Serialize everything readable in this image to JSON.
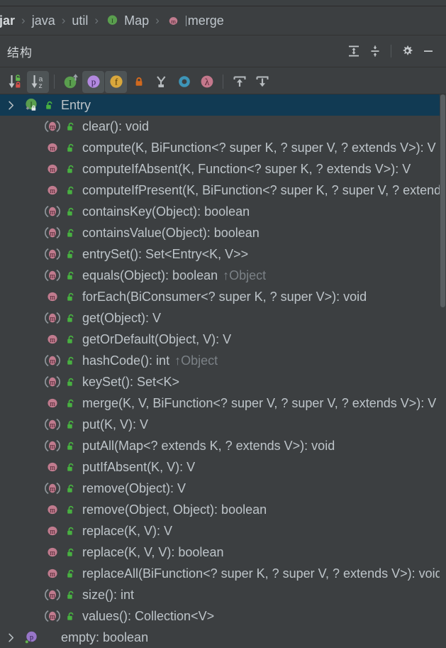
{
  "colors": {
    "background": "#3c3f41",
    "selection": "#113a53",
    "text": "#bdc4c9",
    "inherited_text": "#7b8186",
    "method_icon": "#c07b8e",
    "property_icon": "#9876c8",
    "field_icon": "#d4a24a",
    "interface_icon": "#5a9e4e",
    "lock_green": "#4caf50",
    "lock_red": "#d9534f",
    "lock_orange": "#d2691e",
    "lambda_icon": "#c4788c",
    "interface_ring": "#3d95b8"
  },
  "breadcrumb": {
    "items": [
      {
        "label": ".jar",
        "icon": null,
        "bold": true
      },
      {
        "label": "java",
        "icon": null,
        "bold": false
      },
      {
        "label": "util",
        "icon": null,
        "bold": false
      },
      {
        "label": "Map",
        "icon": "interface-icon",
        "bold": false
      },
      {
        "label": "merge",
        "icon": "method-icon",
        "bold": false
      }
    ],
    "separator": "›"
  },
  "panel": {
    "title": "结构",
    "buttons": [
      {
        "name": "expand-all-button",
        "tooltip": "Expand All"
      },
      {
        "name": "collapse-all-button",
        "tooltip": "Collapse All"
      },
      {
        "name": "settings-button",
        "tooltip": "Settings"
      },
      {
        "name": "hide-button",
        "tooltip": "Hide"
      }
    ]
  },
  "toolbar": {
    "buttons": [
      {
        "name": "sort-by-visibility-button",
        "label": "Sort by Visibility",
        "active": false
      },
      {
        "name": "sort-alphabetically-button",
        "label": "Sort Alphabetically",
        "active": true
      },
      {
        "name": "show-inherited-button",
        "label": "Show Inherited",
        "active": false
      },
      {
        "name": "show-properties-button",
        "label": "Show Properties",
        "active": true
      },
      {
        "name": "show-fields-button",
        "label": "Show Fields",
        "active": true
      },
      {
        "name": "show-non-public-button",
        "label": "Show Non-Public",
        "active": false
      },
      {
        "name": "show-anonymous-classes-button",
        "label": "Show Anonymous Classes",
        "active": false
      },
      {
        "name": "show-interfaces-button",
        "label": "Show Interfaces",
        "active": false
      },
      {
        "name": "show-lambdas-button",
        "label": "Show Lambdas",
        "active": false
      },
      {
        "name": "expand-all-button",
        "label": "Expand All",
        "active": false
      },
      {
        "name": "collapse-all-button",
        "label": "Collapse All",
        "active": false
      }
    ]
  },
  "tree": {
    "rows": [
      {
        "label": "Entry",
        "kind": "interface",
        "icon": "interface-icon",
        "visibility": "public",
        "selected": true,
        "expandable": true,
        "inherited": ""
      },
      {
        "label": "clear(): void",
        "kind": "method-abstract",
        "icon": "method-icon",
        "visibility": "public",
        "selected": false,
        "expandable": false,
        "inherited": ""
      },
      {
        "label": "compute(K, BiFunction<? super K, ? super V, ? extends V>): V",
        "kind": "method",
        "icon": "method-icon",
        "visibility": "public",
        "selected": false,
        "expandable": false,
        "inherited": ""
      },
      {
        "label": "computeIfAbsent(K, Function<? super K, ? extends V>): V",
        "kind": "method",
        "icon": "method-icon",
        "visibility": "public",
        "selected": false,
        "expandable": false,
        "inherited": ""
      },
      {
        "label": "computeIfPresent(K, BiFunction<? super K, ? super V, ? extends V>): V",
        "kind": "method",
        "icon": "method-icon",
        "visibility": "public",
        "selected": false,
        "expandable": false,
        "inherited": ""
      },
      {
        "label": "containsKey(Object): boolean",
        "kind": "method-abstract",
        "icon": "method-icon",
        "visibility": "public",
        "selected": false,
        "expandable": false,
        "inherited": ""
      },
      {
        "label": "containsValue(Object): boolean",
        "kind": "method-abstract",
        "icon": "method-icon",
        "visibility": "public",
        "selected": false,
        "expandable": false,
        "inherited": ""
      },
      {
        "label": "entrySet(): Set<Entry<K, V>>",
        "kind": "method-abstract",
        "icon": "method-icon",
        "visibility": "public",
        "selected": false,
        "expandable": false,
        "inherited": ""
      },
      {
        "label": "equals(Object): boolean",
        "kind": "method-abstract",
        "icon": "method-icon",
        "visibility": "public",
        "selected": false,
        "expandable": false,
        "inherited": "↑Object"
      },
      {
        "label": "forEach(BiConsumer<? super K, ? super V>): void",
        "kind": "method",
        "icon": "method-icon",
        "visibility": "public",
        "selected": false,
        "expandable": false,
        "inherited": ""
      },
      {
        "label": "get(Object): V",
        "kind": "method-abstract",
        "icon": "method-icon",
        "visibility": "public",
        "selected": false,
        "expandable": false,
        "inherited": ""
      },
      {
        "label": "getOrDefault(Object, V): V",
        "kind": "method",
        "icon": "method-icon",
        "visibility": "public",
        "selected": false,
        "expandable": false,
        "inherited": ""
      },
      {
        "label": "hashCode(): int",
        "kind": "method-abstract",
        "icon": "method-icon",
        "visibility": "public",
        "selected": false,
        "expandable": false,
        "inherited": "↑Object"
      },
      {
        "label": "keySet(): Set<K>",
        "kind": "method-abstract",
        "icon": "method-icon",
        "visibility": "public",
        "selected": false,
        "expandable": false,
        "inherited": ""
      },
      {
        "label": "merge(K, V, BiFunction<? super V, ? super V, ? extends V>): V",
        "kind": "method",
        "icon": "method-icon",
        "visibility": "public",
        "selected": false,
        "expandable": false,
        "inherited": ""
      },
      {
        "label": "put(K, V): V",
        "kind": "method-abstract",
        "icon": "method-icon",
        "visibility": "public",
        "selected": false,
        "expandable": false,
        "inherited": ""
      },
      {
        "label": "putAll(Map<? extends K, ? extends V>): void",
        "kind": "method-abstract",
        "icon": "method-icon",
        "visibility": "public",
        "selected": false,
        "expandable": false,
        "inherited": ""
      },
      {
        "label": "putIfAbsent(K, V): V",
        "kind": "method",
        "icon": "method-icon",
        "visibility": "public",
        "selected": false,
        "expandable": false,
        "inherited": ""
      },
      {
        "label": "remove(Object): V",
        "kind": "method-abstract",
        "icon": "method-icon",
        "visibility": "public",
        "selected": false,
        "expandable": false,
        "inherited": ""
      },
      {
        "label": "remove(Object, Object): boolean",
        "kind": "method",
        "icon": "method-icon",
        "visibility": "public",
        "selected": false,
        "expandable": false,
        "inherited": ""
      },
      {
        "label": "replace(K, V): V",
        "kind": "method",
        "icon": "method-icon",
        "visibility": "public",
        "selected": false,
        "expandable": false,
        "inherited": ""
      },
      {
        "label": "replace(K, V, V): boolean",
        "kind": "method",
        "icon": "method-icon",
        "visibility": "public",
        "selected": false,
        "expandable": false,
        "inherited": ""
      },
      {
        "label": "replaceAll(BiFunction<? super K, ? super V, ? extends V>): void",
        "kind": "method",
        "icon": "method-icon",
        "visibility": "public",
        "selected": false,
        "expandable": false,
        "inherited": ""
      },
      {
        "label": "size(): int",
        "kind": "method-abstract",
        "icon": "method-icon",
        "visibility": "public",
        "selected": false,
        "expandable": false,
        "inherited": ""
      },
      {
        "label": "values(): Collection<V>",
        "kind": "method-abstract",
        "icon": "method-icon",
        "visibility": "public",
        "selected": false,
        "expandable": false,
        "inherited": ""
      },
      {
        "label": "empty: boolean",
        "kind": "property",
        "icon": "property-icon",
        "visibility": "public",
        "selected": false,
        "expandable": true,
        "inherited": ""
      }
    ]
  }
}
